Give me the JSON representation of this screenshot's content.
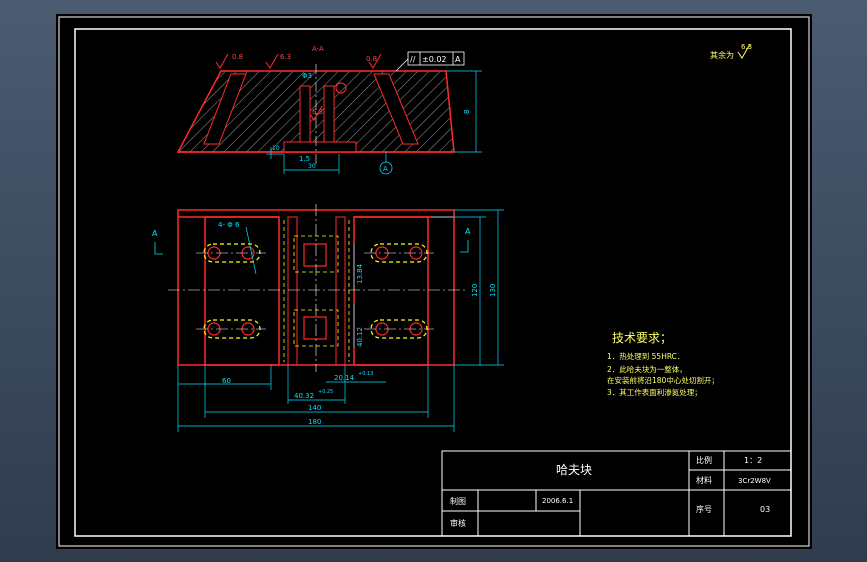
{
  "drawing": {
    "section_label": "A-A",
    "surface_finish_rest_label": "其余为",
    "surface_finish_rest_value": "6.3",
    "roughness_values": [
      "0.8",
      "6.3",
      "6.3",
      "0.8"
    ],
    "tolerance_frame": {
      "symbol": "//",
      "value": "±0.02",
      "datum": "A"
    },
    "datum_label": "A",
    "view_marks": [
      "A",
      "A"
    ],
    "top_dims": {
      "hole": "Φ3",
      "h": "8",
      "d15": "1.5",
      "d30": "30",
      "d10": "10"
    },
    "plan_dims": {
      "hole_note": "4- Φ 6",
      "w60": "60",
      "w140": "140",
      "w180": "180",
      "h120": "120",
      "h130": "130",
      "slot1": "40.32",
      "slot1_tol": "+0.25",
      "slot2": "20.14",
      "slot2_tol": "+0.13",
      "vert1": "13.84",
      "vert2": "40.12"
    },
    "tech_req": {
      "title": "技术要求；",
      "items": [
        "1．热处理到 55HRC．",
        "2．此哈夫块为一整体，",
        "  在安装前将沿180中心处切割开；",
        "3．其工作表面利渗氮处理；"
      ]
    }
  },
  "title_block": {
    "part_name": "哈夫块",
    "scale_label": "比例",
    "scale_value": "1：2",
    "material_label": "材料",
    "material_value": "3Cr2W8V",
    "drawn_label": "制图",
    "drawn_date": "2006.6.1",
    "checked_label": "审核",
    "seq_label": "序号",
    "seq_value": "03"
  },
  "colors": {
    "outline": "#ff2a2a",
    "dimension": "#00e0ff",
    "center": "#ffffff",
    "hidden": "#ffff00",
    "hatch": "#ffffff",
    "text": "#ffff66",
    "frame": "#ffffff"
  }
}
